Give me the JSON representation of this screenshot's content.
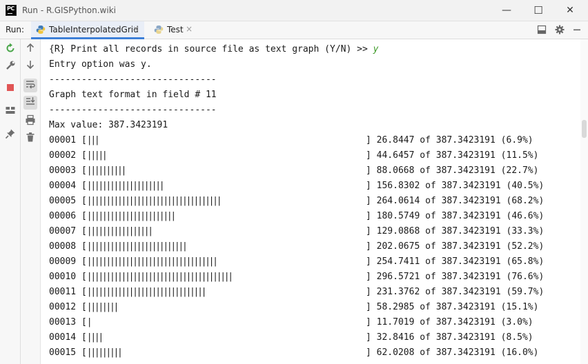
{
  "window": {
    "logo_text": "PC",
    "title": "Run - R.GISPython.wiki",
    "controls": {
      "minimize": "—",
      "maximize": "☐",
      "close": "✕"
    }
  },
  "run_bar": {
    "label": "Run:",
    "tabs": [
      {
        "label": "TableInterpolatedGrid",
        "close": "×",
        "icon": "python-icon",
        "active": true
      },
      {
        "label": "Test",
        "close": "×",
        "icon": "python-icon",
        "active": false
      }
    ],
    "right_icons": [
      "restore-layout-icon",
      "settings-gear-icon",
      "minimize-panel-icon"
    ]
  },
  "left_toolbar": [
    "rerun-icon",
    "wrench-icon",
    "stop-icon",
    "layout-icon",
    "pin-icon"
  ],
  "console_toolbar": [
    "scroll-up-icon",
    "scroll-down-icon",
    "soft-wrap-icon",
    "scroll-to-end-icon",
    "print-icon",
    "trash-icon"
  ],
  "console": {
    "prompt_text": "{R} Print all records in source file as text graph (Y/N) >> ",
    "prompt_input": "y",
    "entry_option": "Entry option was y.",
    "separator_1": "-------------------------------",
    "graph_header": "Graph text format in field # 11",
    "separator_2": "-------------------------------",
    "max_value_line": "Max value: 387.3423191",
    "rows": [
      {
        "id": "00001",
        "bars": "|||",
        "result": "] 26.8447 of 387.3423191 (6.9%)",
        "percent": 6.9
      },
      {
        "id": "00002",
        "bars": "|||||",
        "result": "] 44.6457 of 387.3423191 (11.5%)",
        "percent": 11.5
      },
      {
        "id": "00003",
        "bars": "||||||||||",
        "result": "] 88.0668 of 387.3423191 (22.7%)",
        "percent": 22.7
      },
      {
        "id": "00004",
        "bars": "||||||||||||||||||||",
        "result": "] 156.8302 of 387.3423191 (40.5%)",
        "percent": 40.5
      },
      {
        "id": "00005",
        "bars": "|||||||||||||||||||||||||||||||||||",
        "result": "] 264.0614 of 387.3423191 (68.2%)",
        "percent": 68.2
      },
      {
        "id": "00006",
        "bars": "|||||||||||||||||||||||",
        "result": "] 180.5749 of 387.3423191 (46.6%)",
        "percent": 46.6
      },
      {
        "id": "00007",
        "bars": "|||||||||||||||||",
        "result": "] 129.0868 of 387.3423191 (33.3%)",
        "percent": 33.3
      },
      {
        "id": "00008",
        "bars": "||||||||||||||||||||||||||",
        "result": "] 202.0675 of 387.3423191 (52.2%)",
        "percent": 52.2
      },
      {
        "id": "00009",
        "bars": "||||||||||||||||||||||||||||||||||",
        "result": "] 254.7411 of 387.3423191 (65.8%)",
        "percent": 65.8
      },
      {
        "id": "00010",
        "bars": "||||||||||||||||||||||||||||||||||||||",
        "result": "] 296.5721 of 387.3423191 (76.6%)",
        "percent": 76.6
      },
      {
        "id": "00011",
        "bars": "|||||||||||||||||||||||||||||||",
        "result": "] 231.3762 of 387.3423191 (59.7%)",
        "percent": 59.7
      },
      {
        "id": "00012",
        "bars": "||||||||",
        "result": "] 58.2985 of 387.3423191 (15.1%)",
        "percent": 15.1
      },
      {
        "id": "00013",
        "bars": "|",
        "result": "] 11.7019 of 387.3423191 (3.0%)",
        "percent": 3.0
      },
      {
        "id": "00014",
        "bars": "||||",
        "result": "] 32.8416 of 387.3423191 (8.5%)",
        "percent": 8.5
      },
      {
        "id": "00015",
        "bars": "|||||||||",
        "result": "] 62.0208 of 387.3423191 (16.0%)",
        "percent": 16.0
      }
    ]
  },
  "colors": {
    "input_echo": "#3d9a27",
    "active_tab_underline": "#3d7fd8",
    "stop_button": "#e05555",
    "rerun_button": "#4aa64a"
  }
}
